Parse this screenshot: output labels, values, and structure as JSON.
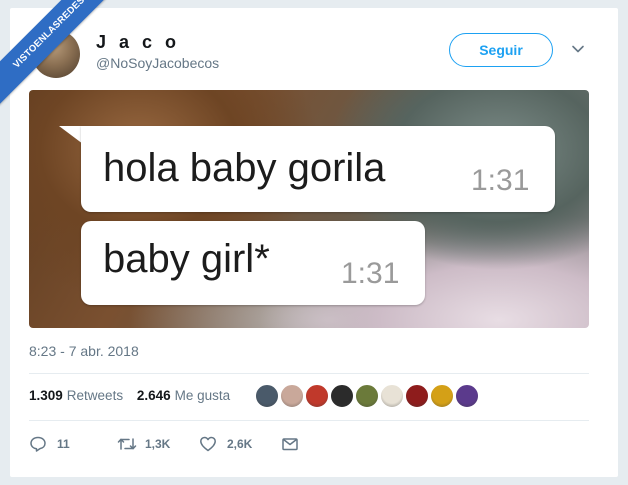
{
  "watermark": "VISTOENLASREDES",
  "author": {
    "name": "J a c o",
    "handle": "@NoSoyJacobecos"
  },
  "follow_button": "Seguir",
  "media": {
    "messages": [
      {
        "text": "hola baby gorila",
        "time": "1:31"
      },
      {
        "text": "baby girl*",
        "time": "1:31"
      }
    ]
  },
  "timestamp": "8:23 - 7 abr. 2018",
  "stats": {
    "retweets_value": "1.309",
    "retweets_label": "Retweets",
    "likes_value": "2.646",
    "likes_label": "Me gusta"
  },
  "likers": [
    {
      "color": "#4a5a6a"
    },
    {
      "color": "#c9a89a"
    },
    {
      "color": "#c0392b"
    },
    {
      "color": "#2b2b2b"
    },
    {
      "color": "#6b7a3a"
    },
    {
      "color": "#e8e2d6"
    },
    {
      "color": "#8e1c1c"
    },
    {
      "color": "#d4a017"
    },
    {
      "color": "#5b3a8c"
    }
  ],
  "actions": {
    "reply_count": "11",
    "retweet_count": "1,3K",
    "like_count": "2,6K"
  },
  "colors": {
    "accent": "#1da1f2",
    "muted": "#657786",
    "watermark_blue": "#2f6dc4"
  }
}
